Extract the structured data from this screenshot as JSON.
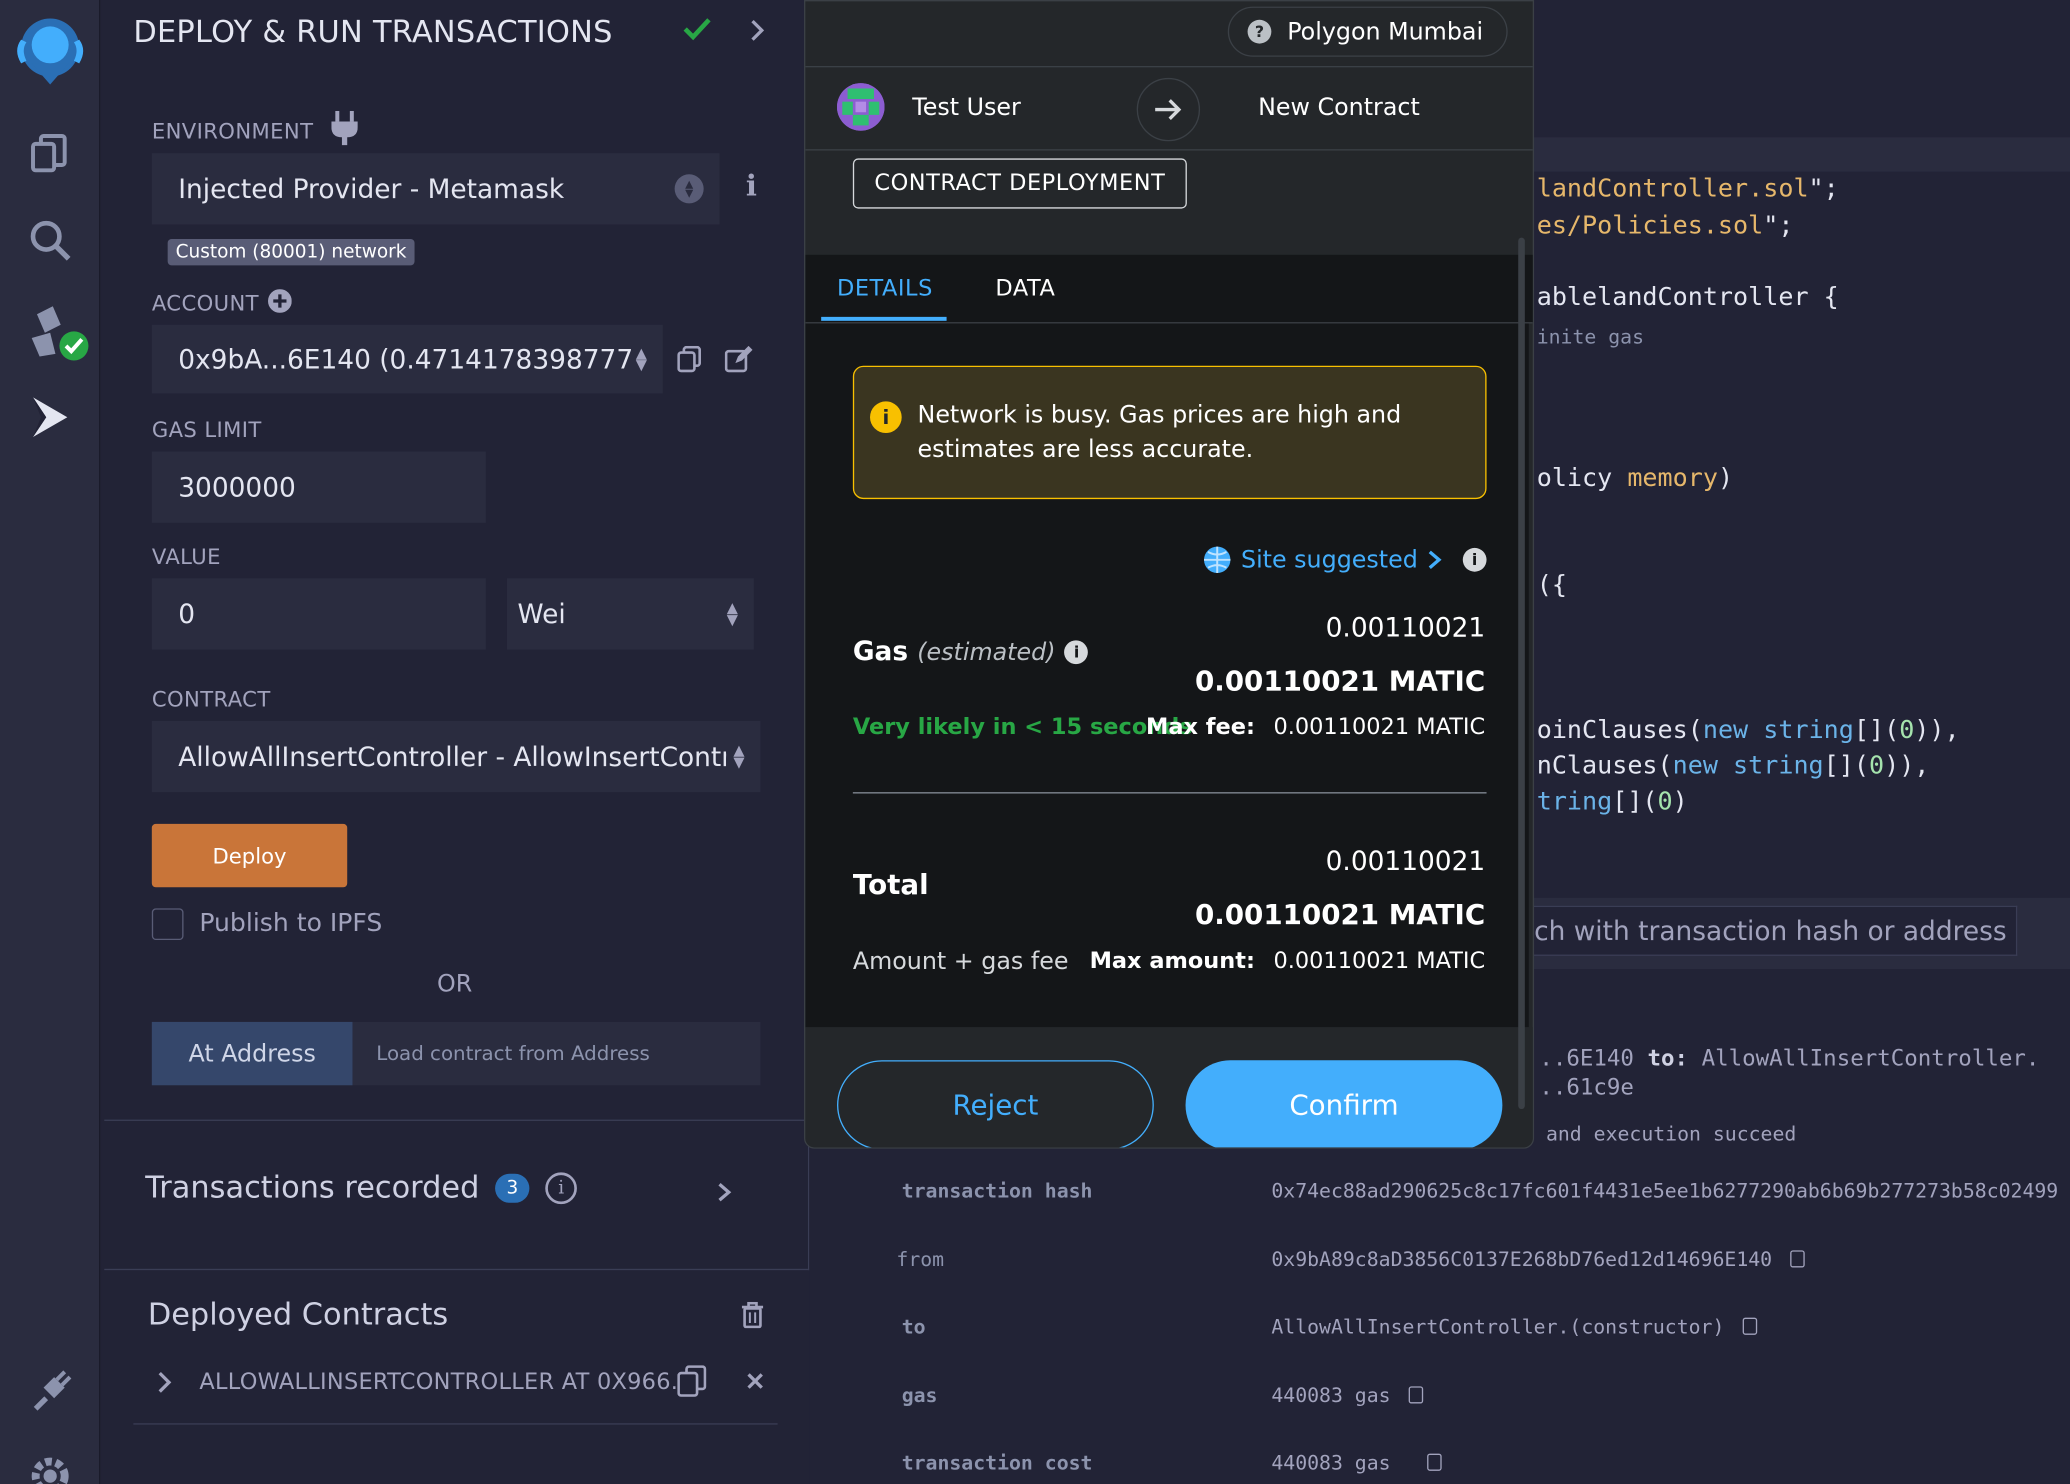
{
  "remix": {
    "panel_title": "DEPLOY & RUN TRANSACTIONS",
    "environment_label": "ENVIRONMENT",
    "environment_value": "Injected Provider - Metamask",
    "network_badge": "Custom (80001) network",
    "account_label": "ACCOUNT",
    "account_value": "0x9bA...6E140 (0.4714178398777",
    "gas_limit_label": "GAS LIMIT",
    "gas_limit_value": "3000000",
    "value_label": "VALUE",
    "value_amount": "0",
    "value_unit": "Wei",
    "contract_label": "CONTRACT",
    "contract_value": "AllowAllInsertController - AllowInsertContr",
    "deploy_label": "Deploy",
    "publish_label": "Publish to IPFS",
    "or_label": "OR",
    "at_address_label": "At Address",
    "at_address_placeholder": "Load contract from Address",
    "tx_recorded_label": "Transactions recorded",
    "tx_recorded_count": "3",
    "deployed_label": "Deployed Contracts",
    "deployed_item": "ALLOWALLINSERTCONTROLLER AT 0X966."
  },
  "editor_lines": [
    {
      "a": "landController.sol",
      "b": "\";"
    },
    {
      "a": "es/Policies.sol",
      "b": "\";"
    },
    {
      "text": "ablelandController {"
    },
    {
      "comment": "inite gas"
    },
    {
      "a": "olicy ",
      "b": "memory",
      "c": ")"
    },
    {
      "text": "({"
    },
    {
      "a": "oinClauses(",
      "kw": "new string",
      "c": "[](",
      "num": "0",
      "d": ")),"
    },
    {
      "a": "nClauses(",
      "kw": "new string",
      "c": "[](",
      "num": "0",
      "d": ")),"
    },
    {
      "kw": "tring",
      "c": "[](",
      "num": "0",
      "d": ")"
    }
  ],
  "terminal": {
    "search_placeholder": "ch with transaction hash or address",
    "log_line1_a": "..6E140",
    "log_line1_to": "to:",
    "log_line1_b": "AllowAllInsertController.",
    "log_line2": "..61c9e",
    "log_line3": "and execution succeed",
    "rows": [
      {
        "key": "transaction hash",
        "value": "0x74ec88ad290625c8c17fc601f4431e5ee1b6277290ab6b69b277273b58c02499"
      },
      {
        "key": "from",
        "value": "0x9bA89c8aD3856C0137E268bD76ed12d14696E140"
      },
      {
        "key": "to",
        "value": "AllowAllInsertController.(constructor)"
      },
      {
        "key": "gas",
        "value": "440083 gas"
      },
      {
        "key": "transaction cost",
        "value": "440083 gas"
      }
    ]
  },
  "metamask": {
    "network": "Polygon Mumbai",
    "from_account": "Test User",
    "to_account": "New Contract",
    "tag": "CONTRACT DEPLOYMENT",
    "tab_details": "DETAILS",
    "tab_data": "DATA",
    "warning": "Network is busy. Gas prices are high and estimates are less accurate.",
    "site_suggested": "Site suggested",
    "gas_label": "Gas",
    "gas_estimated": "(estimated)",
    "gas_value": "0.00110021",
    "gas_value_matic": "0.00110021 MATIC",
    "likely": "Very likely in < 15 seconds",
    "max_fee_label": "Max fee:",
    "max_fee_value": "0.00110021 MATIC",
    "total_label": "Total",
    "total_value": "0.00110021",
    "total_value_matic": "0.00110021 MATIC",
    "amount_gas_fee": "Amount + gas fee",
    "max_amount_label": "Max amount:",
    "max_amount_value": "0.00110021 MATIC",
    "reject_label": "Reject",
    "confirm_label": "Confirm"
  },
  "colors": {
    "remix_bg": "#222336",
    "deploy_orange": "#c97539",
    "mm_blue": "#43aefc",
    "mm_green": "#28a745",
    "warn_yellow": "#f8c000"
  },
  "icons": [
    "remix-logo-icon",
    "file-explorer-icon",
    "search-icon",
    "compiler-icon",
    "deploy-icon",
    "plugin-icon",
    "settings-icon",
    "plug-icon",
    "check-icon",
    "chevron-right-icon",
    "info-icon",
    "add-account-icon",
    "copy-icon",
    "edit-icon",
    "trash-icon",
    "close-icon",
    "arrow-right-icon",
    "globe-icon",
    "help-icon"
  ]
}
